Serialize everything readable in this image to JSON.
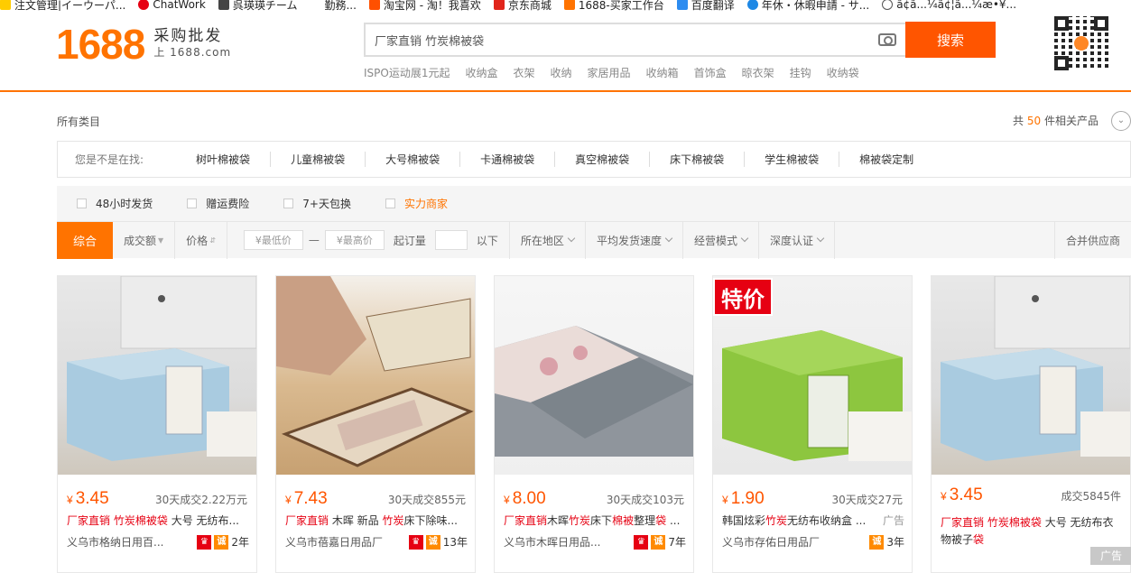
{
  "bookmarks": [
    "注文管理|イーウーパ...",
    "ChatWork",
    "呉瑛瑛チーム",
    "勤務...",
    "淘宝网 - 淘！我喜欢",
    "京东商城",
    "1688-买家工作台",
    "百度翻译",
    "年休・休暇申請 - サ...",
    "ã¢ã...¼ã¢¦ã...¼æ•¥..."
  ],
  "logo": {
    "num": "1688",
    "cn": "采购批发",
    "url": "上 1688.com"
  },
  "search": {
    "value": "厂家直销 竹炭棉被袋",
    "button": "搜索"
  },
  "hot": [
    "ISPO运动展1元起",
    "收纳盒",
    "衣架",
    "收纳",
    "家居用品",
    "收纳箱",
    "首饰盒",
    "晾衣架",
    "挂钩",
    "收纳袋"
  ],
  "all_categories": "所有类目",
  "count": {
    "prefix": "共",
    "num": "50",
    "suffix": "件相关产品"
  },
  "suggest": {
    "label": "您是不是在找:",
    "items": [
      "树叶棉被袋",
      "儿童棉被袋",
      "大号棉被袋",
      "卡通棉被袋",
      "真空棉被袋",
      "床下棉被袋",
      "学生棉被袋",
      "棉被袋定制"
    ]
  },
  "filters": [
    "48小时发货",
    "赠运费险",
    "7+天包换",
    "实力商家"
  ],
  "sort": {
    "active": "综合",
    "sales": "成交额",
    "price": "价格",
    "min": "¥最低价",
    "dash": "—",
    "max": "¥最高价",
    "moq": "起订量",
    "below": "以下",
    "region": "所在地区",
    "speed": "平均发货速度",
    "mode": "经营模式",
    "auth": "深度认证",
    "merge": "合并供应商"
  },
  "products": [
    {
      "currency": "¥",
      "price": "3.45",
      "sold": "30天成交2.22万元",
      "red1": "厂家直销",
      "red2": "竹炭棉被袋",
      "rest": "大号 无纺布...",
      "company": "义乌市格纳日用百...",
      "years": "2年"
    },
    {
      "currency": "¥",
      "price": "7.43",
      "sold": "30天成交855元",
      "red1": "厂家直销",
      "mid": "木晖 新品",
      "red2": "竹炭",
      "rest": "床下除味...",
      "company": "义乌市蓓嘉日用品厂",
      "years": "13年"
    },
    {
      "currency": "¥",
      "price": "8.00",
      "sold": "30天成交103元",
      "red1": "厂家直销",
      "mid": "木晖",
      "red2": "竹炭",
      "rest": "床下",
      "red3": "棉被",
      "rest2": "整理",
      "red4": "袋",
      "rest3": "...",
      "company": "义乌市木晖日用品...",
      "years": "7年"
    },
    {
      "currency": "¥",
      "price": "1.90",
      "sold": "30天成交27元",
      "tag": "特价",
      "pre": "韩国炫彩",
      "red2": "竹炭",
      "rest": "无纺布收纳盒 ...",
      "ad": "广告",
      "company": "义乌市存佑日用品厂",
      "years": "3年"
    },
    {
      "currency": "¥",
      "price": "3.45",
      "sold": "成交5845件",
      "red1": "厂家直销",
      "red2": "竹炭棉被袋",
      "rest": "大号 无纺布衣",
      "line2": "物被子",
      "red3": "袋",
      "ad": "广告"
    }
  ]
}
